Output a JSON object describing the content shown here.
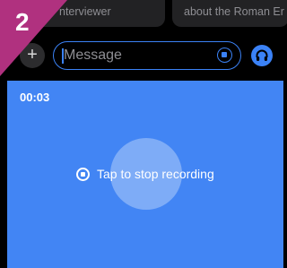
{
  "step_badge": {
    "number": "2",
    "color": "#b0317f"
  },
  "suggestions": [
    {
      "label": "nterviewer"
    },
    {
      "label": "about the Roman Er"
    }
  ],
  "composer": {
    "plus_label": "+",
    "placeholder": "Message",
    "accent": "#3b82f6"
  },
  "recording": {
    "timer": "00:03",
    "stop_label": "Tap to stop recording",
    "panel_color": "#4285f4"
  },
  "icons": {
    "plus": "plus-icon",
    "stop_small": "stop-circle-icon",
    "voice": "headphones-icon",
    "stop": "stop-circle-icon"
  }
}
